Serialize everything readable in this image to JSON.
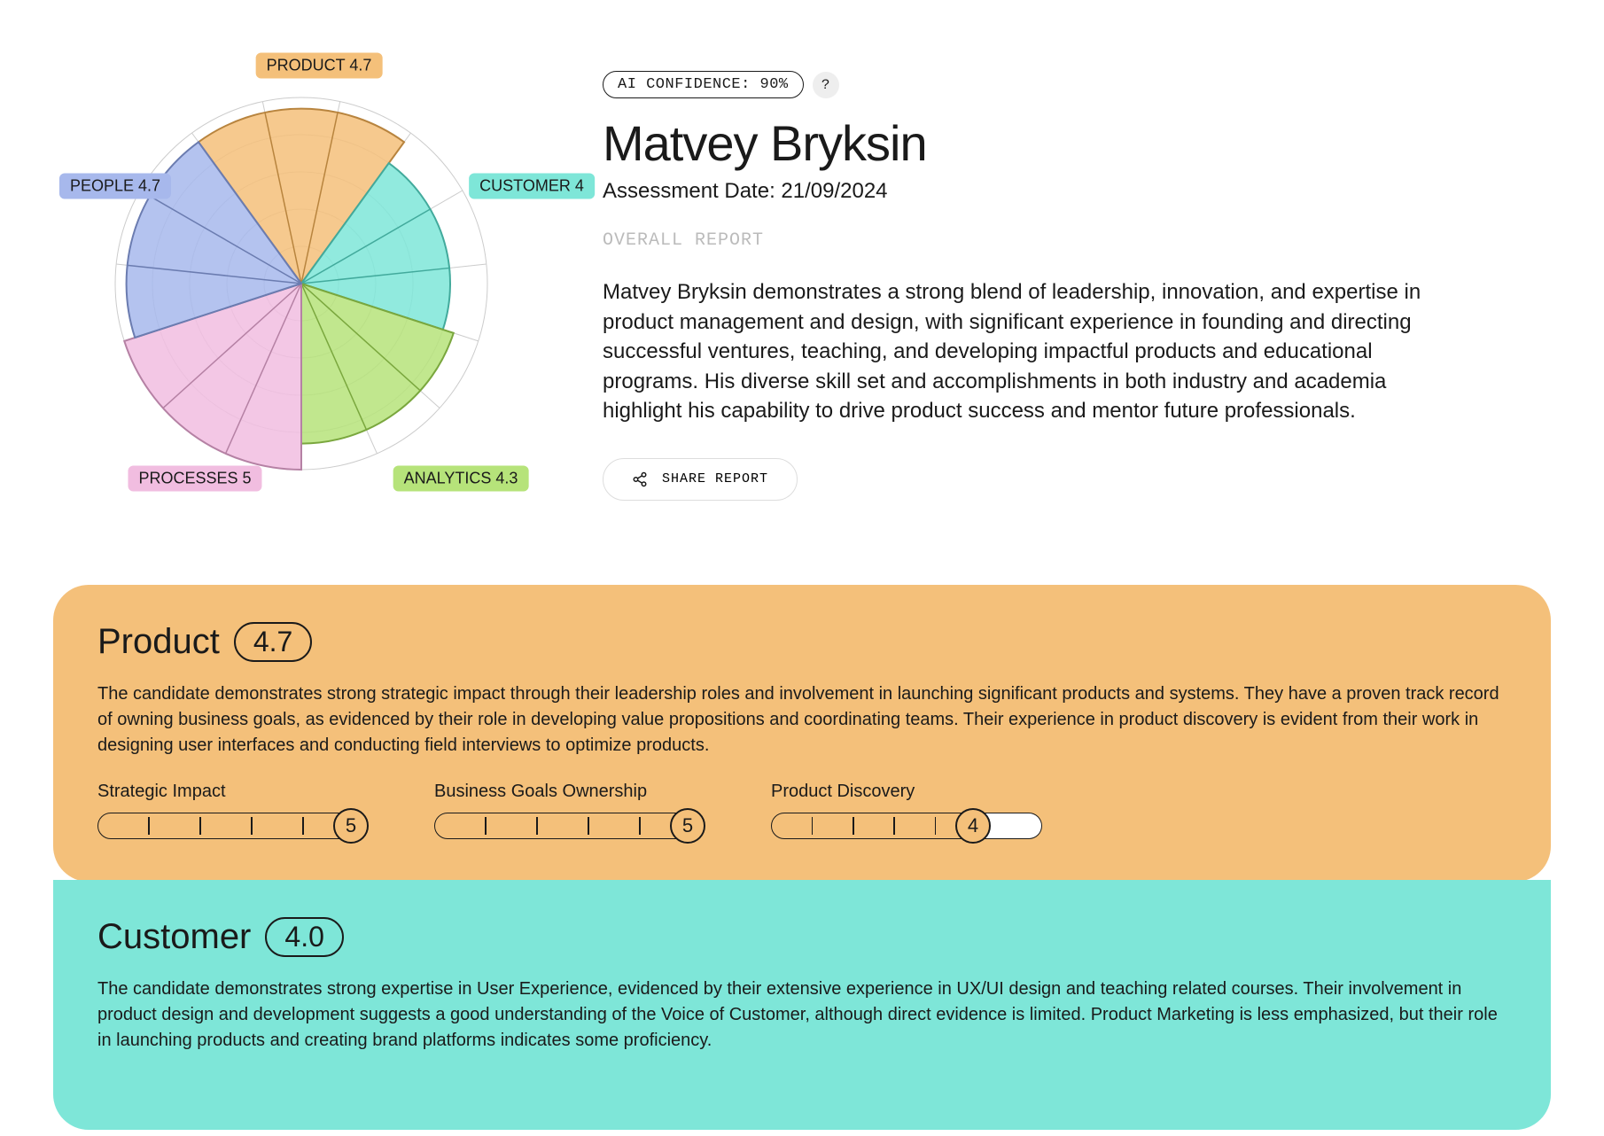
{
  "confidence_label": "AI CONFIDENCE: 90%",
  "help_glyph": "?",
  "name": "Matvey Bryksin",
  "date_line": "Assessment Date: 21/09/2024",
  "overall_label": "OVERALL REPORT",
  "summary": "Matvey Bryksin demonstrates a strong blend of leadership, innovation, and expertise in product management and design, with significant experience in founding and directing successful ventures, teaching, and developing impactful products and educational programs. His diverse skill set and accomplishments in both industry and academia highlight his capability to drive product success and mentor future professionals.",
  "share_label": "SHARE REPORT",
  "chart_data": {
    "type": "bar",
    "title": "",
    "categories": [
      "PRODUCT",
      "CUSTOMER",
      "ANALYTICS",
      "PROCESSES",
      "PEOPLE"
    ],
    "values": [
      4.7,
      4.0,
      4.3,
      5.0,
      4.7
    ],
    "ylim": [
      0,
      5
    ],
    "series_labels": [
      {
        "text": "PRODUCT 4.7",
        "color": "#f4c07a"
      },
      {
        "text": "CUSTOMER 4",
        "color": "#7ee6d8"
      },
      {
        "text": "ANALYTICS 4.3",
        "color": "#b6e37a"
      },
      {
        "text": "PROCESSES 5",
        "color": "#f1bde0"
      },
      {
        "text": "PEOPLE 4.7",
        "color": "#a7b8ec"
      }
    ],
    "colors": [
      "#f4c07a",
      "#7ee6d8",
      "#b6e37a",
      "#f1bde0",
      "#a7b8ec"
    ]
  },
  "sections": {
    "product": {
      "title": "Product",
      "score": "4.7",
      "body": "The candidate demonstrates strong strategic impact through their leadership roles and involvement in launching significant products and systems. They have a proven track record of owning business goals, as evidenced by their role in developing value propositions and coordinating teams. Their experience in product discovery is evident from their work in designing user interfaces and conducting field interviews to optimize products.",
      "skills": [
        {
          "name": "Strategic Impact",
          "score": 5
        },
        {
          "name": "Business Goals Ownership",
          "score": 5
        },
        {
          "name": "Product Discovery",
          "score": 4
        }
      ]
    },
    "customer": {
      "title": "Customer",
      "score": "4.0",
      "body": "The candidate demonstrates strong expertise in User Experience, evidenced by their extensive experience in UX/UI design and teaching related courses. Their involvement in product design and development suggests a good understanding of the Voice of Customer, although direct evidence is limited. Product Marketing is less emphasized, but their role in launching products and creating brand platforms indicates some proficiency."
    }
  }
}
